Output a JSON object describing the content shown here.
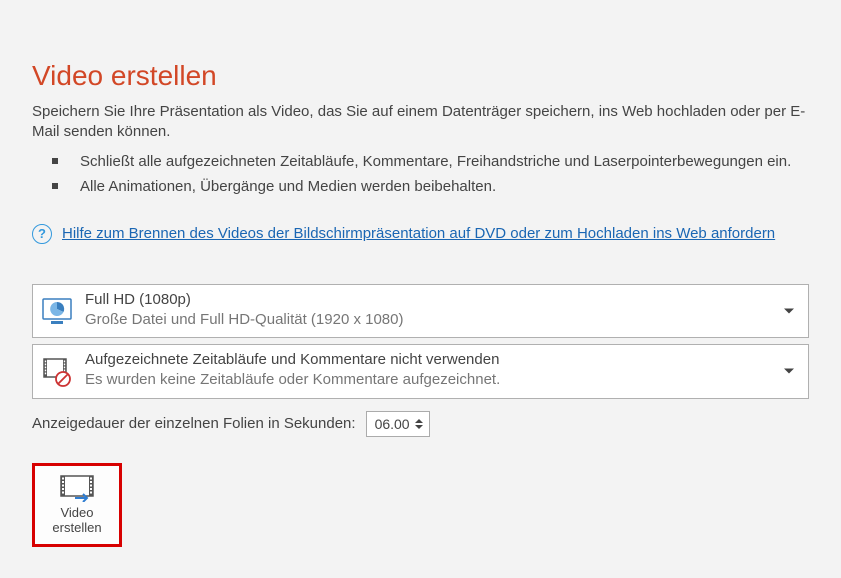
{
  "title": "Video erstellen",
  "intro": "Speichern Sie Ihre Präsentation als Video, das Sie auf einem Datenträger speichern, ins Web hochladen oder per E-Mail senden können.",
  "bullets": [
    "Schließt alle aufgezeichneten Zeitabläufe, Kommentare, Freihandstriche und Laserpointerbewegungen ein.",
    "Alle Animationen, Übergänge und Medien werden beibehalten."
  ],
  "helpLink": "Hilfe zum Brennen des Videos der Bildschirmpräsentation auf DVD oder zum Hochladen ins Web anfordern",
  "quality": {
    "line1": "Full HD (1080p)",
    "line2": "Große Datei und Full HD-Qualität (1920 x 1080)"
  },
  "timings": {
    "line1": "Aufgezeichnete Zeitabläufe und Kommentare nicht verwenden",
    "line2": "Es wurden keine Zeitabläufe oder Kommentare aufgezeichnet."
  },
  "duration": {
    "label": "Anzeigedauer der einzelnen Folien in Sekunden:",
    "value": "06.00"
  },
  "createButton": {
    "line1": "Video",
    "line2": "erstellen"
  }
}
